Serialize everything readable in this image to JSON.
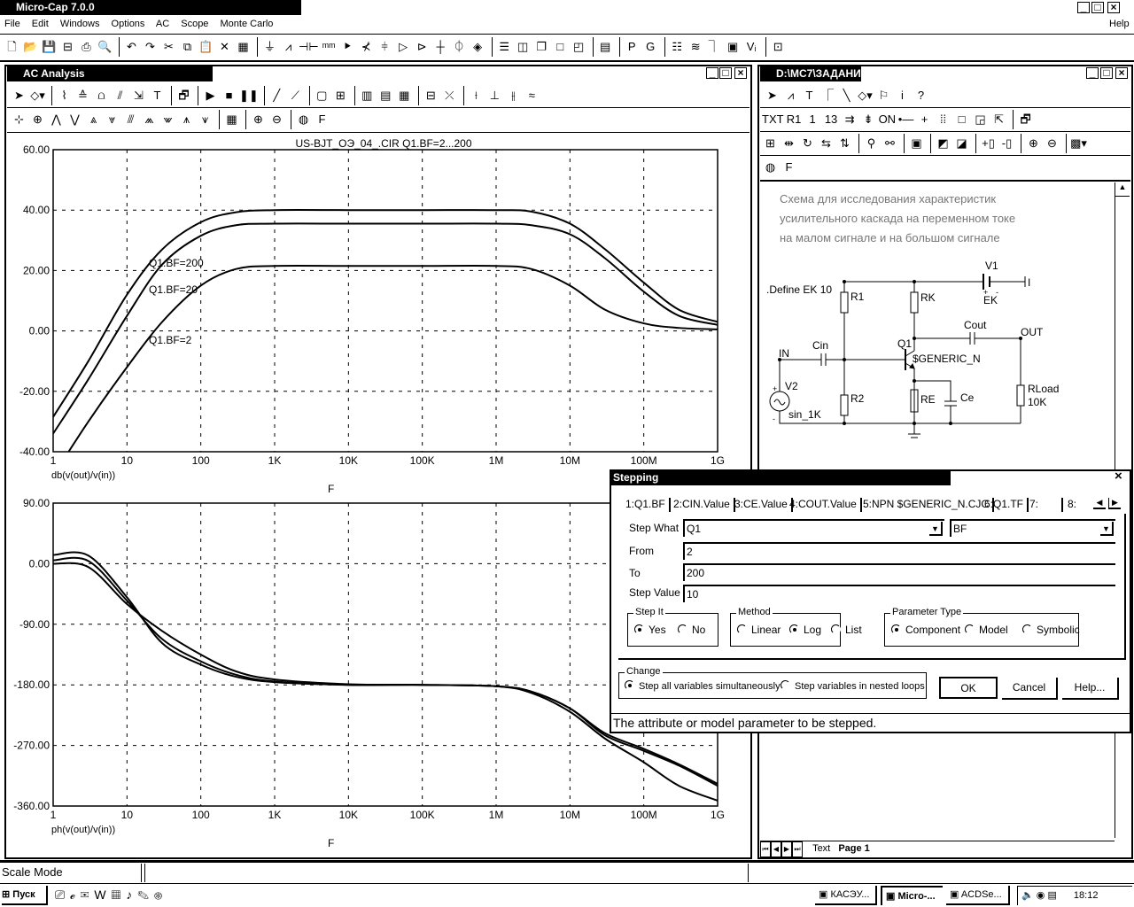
{
  "app": {
    "title": "Micro-Cap 7.0.0",
    "min": "_",
    "max": "□",
    "close": "×"
  },
  "menu": {
    "items": [
      "File",
      "Edit",
      "Windows",
      "Options",
      "AC",
      "Scope",
      "Monte Carlo"
    ],
    "help": "Help"
  },
  "main_toolbar": [
    {
      "n": "new-file-icon",
      "g": "🗋"
    },
    {
      "n": "open-folder-icon",
      "g": "📂"
    },
    {
      "n": "save-icon",
      "g": "💾"
    },
    {
      "n": "save-as-icon",
      "g": "⊟"
    },
    {
      "n": "print-icon",
      "g": "⎙"
    },
    {
      "n": "print-preview-icon",
      "g": "🔍"
    },
    {
      "sep": 1
    },
    {
      "n": "undo-icon",
      "g": "↶"
    },
    {
      "n": "redo-icon",
      "g": "↷"
    },
    {
      "n": "cut-icon",
      "g": "✂"
    },
    {
      "n": "copy-icon",
      "g": "⧉"
    },
    {
      "n": "paste-icon",
      "g": "📋"
    },
    {
      "n": "delete-icon",
      "g": "✕"
    },
    {
      "n": "select-all-icon",
      "g": "▦"
    },
    {
      "sep": 1
    },
    {
      "n": "ground-icon",
      "g": "⏚"
    },
    {
      "n": "resistor-icon",
      "g": "⩘"
    },
    {
      "n": "capacitor-icon",
      "g": "⊣⊢"
    },
    {
      "n": "inductor-icon",
      "g": "ᵐᵐ"
    },
    {
      "n": "diode-icon",
      "g": "⯈"
    },
    {
      "n": "bjt-icon",
      "g": "⊀"
    },
    {
      "n": "mosfet-icon",
      "g": "⫩"
    },
    {
      "n": "opamp-icon",
      "g": "▷"
    },
    {
      "n": "buffer-icon",
      "g": "⊳"
    },
    {
      "n": "wire-node-icon",
      "g": "┼"
    },
    {
      "n": "voltage-source-icon",
      "g": "⏀"
    },
    {
      "n": "current-source-icon",
      "g": "◈"
    },
    {
      "sep": 1
    },
    {
      "n": "tile-horizontal-icon",
      "g": "☰"
    },
    {
      "n": "tile-vertical-icon",
      "g": "◫"
    },
    {
      "n": "cascade-icon",
      "g": "❐"
    },
    {
      "n": "window-icon",
      "g": "□"
    },
    {
      "n": "window2-icon",
      "g": "◰"
    },
    {
      "sep": 1
    },
    {
      "n": "calculator-icon",
      "g": "▤"
    },
    {
      "sep": 1
    },
    {
      "n": "probe-p-icon",
      "g": "P"
    },
    {
      "n": "probe-g-icon",
      "g": "G"
    },
    {
      "sep": 1
    },
    {
      "n": "component-list-icon",
      "g": "☷"
    },
    {
      "n": "waveform-icon",
      "g": "≋"
    },
    {
      "n": "sources-icon",
      "g": "⏋"
    },
    {
      "n": "library-icon",
      "g": "▣"
    },
    {
      "n": "vi-icon",
      "g": "Vᵢ"
    },
    {
      "sep": 1
    },
    {
      "n": "check-icon",
      "g": "⊡"
    }
  ],
  "ac_window": {
    "title": "AC Analysis",
    "toolbar1": [
      {
        "n": "select-arrow-icon",
        "g": "➤"
      },
      {
        "n": "shapes-icon",
        "g": "◇▾"
      },
      {
        "sep": 1
      },
      {
        "n": "scale-icon",
        "g": "⌇"
      },
      {
        "n": "data-points-icon",
        "g": "≙"
      },
      {
        "n": "tokens-icon",
        "g": "⩍"
      },
      {
        "n": "ruler-icon",
        "g": "⫽"
      },
      {
        "n": "horizontal-tag-icon",
        "g": "⇲"
      },
      {
        "n": "text-icon",
        "g": "T"
      },
      {
        "sep": 1
      },
      {
        "n": "properties-icon",
        "g": "🗗"
      },
      {
        "sep": 1
      },
      {
        "n": "run-icon",
        "g": "▶"
      },
      {
        "n": "stop-icon",
        "g": "■"
      },
      {
        "n": "pause-icon",
        "g": "❚❚"
      },
      {
        "sep": 1
      },
      {
        "n": "line-icon",
        "g": "╱"
      },
      {
        "n": "line-dots-icon",
        "g": "⟋"
      },
      {
        "sep": 1
      },
      {
        "n": "grid-frame-icon",
        "g": "▢"
      },
      {
        "n": "grid-icon",
        "g": "⊞"
      },
      {
        "sep": 1
      },
      {
        "n": "vertical-grid-icon",
        "g": "▥"
      },
      {
        "n": "horizontal-grid-icon",
        "g": "▤"
      },
      {
        "n": "minor-grid-icon",
        "g": "▦"
      },
      {
        "sep": 1
      },
      {
        "n": "baseline-icon",
        "g": "⊟"
      },
      {
        "n": "xy-icon",
        "g": "⤫"
      },
      {
        "sep": 1
      },
      {
        "n": "cursor-left-icon",
        "g": "⟊"
      },
      {
        "n": "cursor-right-icon",
        "g": "⊥"
      },
      {
        "n": "cursor-both-icon",
        "g": "⫲"
      },
      {
        "n": "waves-icon",
        "g": "≈"
      }
    ],
    "toolbar2": [
      {
        "n": "next-point-icon",
        "g": "⊹"
      },
      {
        "n": "prev-point-icon",
        "g": "⊕"
      },
      {
        "n": "peak-icon",
        "g": "⋀"
      },
      {
        "n": "valley-icon",
        "g": "⋁"
      },
      {
        "n": "high-icon",
        "g": "⩓"
      },
      {
        "n": "low-icon",
        "g": "⩔"
      },
      {
        "n": "inflection-icon",
        "g": "⫻"
      },
      {
        "n": "global-high-icon",
        "g": "⩕"
      },
      {
        "n": "global-low-icon",
        "g": "⩖"
      },
      {
        "n": "top-icon",
        "g": "⩚"
      },
      {
        "n": "bottom-icon",
        "g": "⩛"
      },
      {
        "sep": 1
      },
      {
        "n": "table-icon",
        "g": "▦"
      },
      {
        "sep": 1
      },
      {
        "n": "zoom-in-icon",
        "g": "⊕"
      },
      {
        "n": "zoom-out-icon",
        "g": "⊖"
      },
      {
        "sep": 1
      },
      {
        "n": "color-icon",
        "g": "◍"
      },
      {
        "n": "font-icon",
        "g": "F"
      }
    ],
    "plot_title": "US-BJT_OЭ_04_.CIR Q1.BF=2...200"
  },
  "chart_data": [
    {
      "type": "line",
      "title": "US-BJT_OЭ_04_.CIR Q1.BF=2...200",
      "xlabel": "F",
      "ylabel": "db(v(out)/v(in))",
      "xscale": "log",
      "xlim": [
        1,
        1000000000.0
      ],
      "ylim": [
        -40,
        60
      ],
      "grid": true,
      "xticks": [
        {
          "v": 1,
          "t": "1"
        },
        {
          "v": 10,
          "t": "10"
        },
        {
          "v": 100,
          "t": "100"
        },
        {
          "v": 1000.0,
          "t": "1K"
        },
        {
          "v": 10000.0,
          "t": "10K"
        },
        {
          "v": 100000.0,
          "t": "100K"
        },
        {
          "v": 1000000.0,
          "t": "1M"
        },
        {
          "v": 10000000.0,
          "t": "10M"
        },
        {
          "v": 100000000.0,
          "t": "100M"
        },
        {
          "v": 1000000000.0,
          "t": "1G"
        }
      ],
      "yticks": [
        {
          "v": 60,
          "t": "60.00"
        },
        {
          "v": 40,
          "t": "40.00"
        },
        {
          "v": 20,
          "t": "20.00"
        },
        {
          "v": 0,
          "t": "0.00"
        },
        {
          "v": -20,
          "t": "-20.00"
        },
        {
          "v": -40,
          "t": "-40.00"
        }
      ],
      "x": [
        1,
        3,
        10,
        30,
        100,
        300,
        1000,
        10000.0,
        100000.0,
        1000000.0,
        3000000.0,
        10000000.0,
        30000000.0,
        100000000.0,
        300000000.0,
        1000000000.0
      ],
      "series": [
        {
          "name": "Q1.BF=200",
          "values": [
            -28.5,
            -10,
            12,
            27,
            36,
            39.3,
            40,
            40,
            40,
            40,
            39.5,
            35.5,
            27,
            16,
            7,
            3
          ]
        },
        {
          "name": "Q1.BF=20",
          "values": [
            -34,
            -16,
            5,
            22,
            31.5,
            35,
            35.5,
            35.5,
            35.5,
            35.5,
            35,
            32,
            24,
            13,
            5,
            2
          ]
        },
        {
          "name": "Q1.BF=2",
          "values": [
            -48,
            -30,
            -12,
            3,
            15,
            20.5,
            21.5,
            21.5,
            21.5,
            21.5,
            20.5,
            15,
            7,
            2.5,
            1,
            0.5
          ]
        }
      ],
      "annotations": [
        "Q1.BF=200",
        "Q1.BF=20",
        "Q1.BF=2"
      ]
    },
    {
      "type": "line",
      "title": "",
      "xlabel": "F",
      "ylabel": "ph(v(out)/v(in))",
      "xscale": "log",
      "xlim": [
        1,
        1000000000.0
      ],
      "ylim": [
        -360,
        90
      ],
      "grid": true,
      "xticks": [
        {
          "v": 1,
          "t": "1"
        },
        {
          "v": 10,
          "t": "10"
        },
        {
          "v": 100,
          "t": "100"
        },
        {
          "v": 1000.0,
          "t": "1K"
        },
        {
          "v": 10000.0,
          "t": "10K"
        },
        {
          "v": 100000.0,
          "t": "100K"
        },
        {
          "v": 1000000.0,
          "t": "1M"
        },
        {
          "v": 10000000.0,
          "t": "10M"
        },
        {
          "v": 100000000.0,
          "t": "100M"
        },
        {
          "v": 1000000000.0,
          "t": "1G"
        }
      ],
      "yticks": [
        {
          "v": 90,
          "t": "90.00"
        },
        {
          "v": 0,
          "t": "0.00"
        },
        {
          "v": -90,
          "t": "-90.00"
        },
        {
          "v": -180,
          "t": "-180.00"
        },
        {
          "v": -270,
          "t": "-270.00"
        },
        {
          "v": -360,
          "t": "-360.00"
        }
      ],
      "x": [
        1,
        3,
        10,
        30,
        100,
        300,
        1000,
        10000.0,
        100000.0,
        1000000.0,
        3000000.0,
        10000000.0,
        30000000.0,
        100000000.0,
        300000000.0,
        1000000000.0
      ],
      "series": [
        {
          "name": "Q1.BF=200",
          "values": [
            13,
            12,
            -50,
            -118,
            -150,
            -168,
            -176,
            -180,
            -180,
            -182,
            -190,
            -215,
            -255,
            -278,
            -300,
            -330
          ]
        },
        {
          "name": "Q1.BF=20",
          "values": [
            5,
            4,
            -55,
            -112,
            -145,
            -165,
            -175,
            -180,
            -180,
            -182,
            -190,
            -215,
            -252,
            -275,
            -298,
            -327
          ]
        },
        {
          "name": "Q1.BF=2",
          "values": [
            0,
            -5,
            -60,
            -100,
            -135,
            -160,
            -172,
            -179,
            -180,
            -182,
            -192,
            -220,
            -260,
            -295,
            -330,
            -352
          ]
        }
      ]
    }
  ],
  "schematic_window": {
    "title": "D:\\MC7\\ЗАДАНИ",
    "toolbar1": [
      {
        "n": "select-arrow-icon",
        "g": "➤"
      },
      {
        "n": "wire-icon",
        "g": "⩘"
      },
      {
        "n": "text-tool-icon",
        "g": "T"
      },
      {
        "n": "wire-orthogonal-icon",
        "g": "⎾"
      },
      {
        "n": "diagonal-wire-icon",
        "g": "╲"
      },
      {
        "n": "shapes-icon",
        "g": "◇▾"
      },
      {
        "n": "flag-icon",
        "g": "⚐"
      },
      {
        "n": "info-icon",
        "g": "i"
      },
      {
        "n": "help-cursor-icon",
        "g": "?"
      }
    ],
    "toolbar2": [
      {
        "n": "text-mode-icon",
        "g": "TXT"
      },
      {
        "n": "attribute-text-icon",
        "g": "R1"
      },
      {
        "n": "node-numbers-icon",
        "g": "1"
      },
      {
        "n": "node-voltages-icon",
        "g": "13"
      },
      {
        "n": "current-icon",
        "g": "⇉"
      },
      {
        "n": "power-icon",
        "g": "⇟"
      },
      {
        "n": "on-state-icon",
        "g": "ON"
      },
      {
        "n": "pin-connections-icon",
        "g": "•—"
      },
      {
        "n": "crosshair-icon",
        "g": "+"
      },
      {
        "n": "grid-dots-icon",
        "g": "⁞⁞"
      },
      {
        "n": "border-icon",
        "g": "□"
      },
      {
        "n": "title-block-icon",
        "g": "◲"
      },
      {
        "n": "show-pins-icon",
        "g": "⇱"
      },
      {
        "sep": 1
      },
      {
        "n": "properties-icon",
        "g": "🗗"
      }
    ],
    "toolbar3": [
      {
        "n": "rotate-box-icon",
        "g": "⊞"
      },
      {
        "n": "mirror-icon",
        "g": "⇹"
      },
      {
        "n": "rotate-icon",
        "g": "↻"
      },
      {
        "n": "flip-x-icon",
        "g": "⇆"
      },
      {
        "n": "flip-y-icon",
        "g": "⇅"
      },
      {
        "sep": 1
      },
      {
        "n": "find-icon",
        "g": "⚲"
      },
      {
        "n": "find-all-icon",
        "g": "⚯"
      },
      {
        "sep": 1
      },
      {
        "n": "display-icon",
        "g": "▣"
      },
      {
        "sep": 1
      },
      {
        "n": "front-icon",
        "g": "◩"
      },
      {
        "n": "back-icon",
        "g": "◪"
      },
      {
        "sep": 1
      },
      {
        "n": "add-page-icon",
        "g": "+▯"
      },
      {
        "n": "remove-page-icon",
        "g": "-▯"
      },
      {
        "sep": 1
      },
      {
        "n": "zoom-in-icon",
        "g": "⊕"
      },
      {
        "n": "zoom-out-icon",
        "g": "⊖"
      },
      {
        "sep": 1
      },
      {
        "n": "fill-color-icon",
        "g": "▩▾"
      }
    ],
    "toolbar4": [
      {
        "n": "color-icon",
        "g": "◍"
      },
      {
        "n": "font-icon",
        "g": "F"
      }
    ],
    "description": [
      "Схема для исследования характеристик",
      "усилительного каскада на переменном токе",
      "на малом сигнале и на большом сигнале"
    ],
    "define": ".Define EK 10",
    "labels": {
      "v1": "V1",
      "ek": "EK",
      "plus": "+",
      "minus": "-",
      "r1": "R1",
      "rk": "RK",
      "cout": "Cout",
      "out": "OUT",
      "q1": "Q1",
      "model": "$GENERIC_N",
      "cin": "Cin",
      "in": "IN",
      "v2": "V2",
      "sin": "sin_1K",
      "r2": "R2",
      "re": "RE",
      "ce": "Ce",
      "rload": "RLoad",
      "rload_val": "10K",
      "bat_end": "I"
    },
    "page_tabs": {
      "text": "Text",
      "page": "Page 1"
    }
  },
  "stepping": {
    "title": "Stepping",
    "close": "×",
    "tabs": [
      "1:Q1.BF",
      "2:CIN.Value",
      "3:CE.Value",
      "4:COUT.Value",
      "5:NPN $GENERIC_N.CJC",
      "6:Q1.TF",
      "7:",
      "8:"
    ],
    "step_what_label": "Step What",
    "step_what_component": "Q1",
    "step_what_param": "BF",
    "from_label": "From",
    "from": "2",
    "to_label": "To",
    "to": "200",
    "step_value_label": "Step Value",
    "step_value": "10",
    "step_it": {
      "label": "Step It",
      "yes": "Yes",
      "no": "No",
      "selected": "Yes"
    },
    "method": {
      "label": "Method",
      "linear": "Linear",
      "log": "Log",
      "list": "List",
      "selected": "Log"
    },
    "param_type": {
      "label": "Parameter Type",
      "component": "Component",
      "model": "Model",
      "symbolic": "Symbolic",
      "selected": "Component"
    },
    "change": {
      "label": "Change",
      "simultaneous": "Step all variables simultaneously",
      "nested": "Step variables in nested loops",
      "selected": "simultaneous"
    },
    "ok": "OK",
    "cancel": "Cancel",
    "help": "Help...",
    "hint": "The attribute or model parameter to be stepped."
  },
  "status": {
    "mode": "Scale Mode"
  },
  "taskbar": {
    "start": "Пуск",
    "tasks": [
      "КАСЭУ...",
      "Micro-...",
      "ACDSe..."
    ],
    "clock": "18:12"
  }
}
